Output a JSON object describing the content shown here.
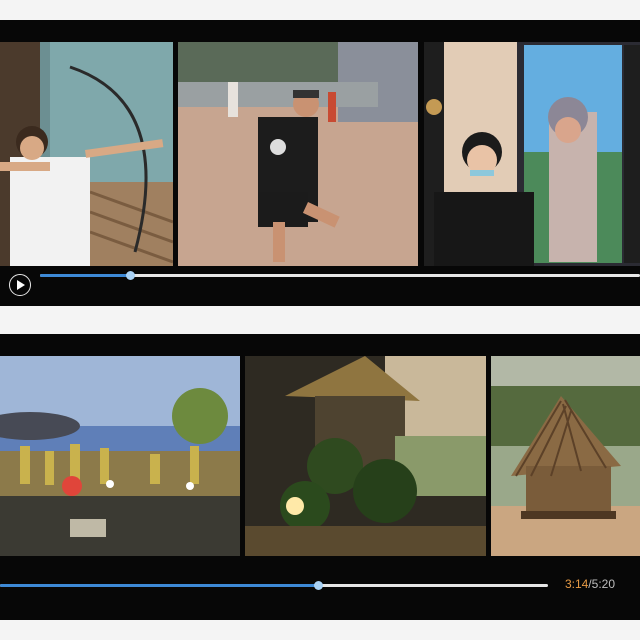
{
  "player1": {
    "progress": 0.15,
    "frames": [
      "archery-photo",
      "park-plaza-photo",
      "display-screen-photo"
    ]
  },
  "player2": {
    "progress": 0.58,
    "time_current": "3:14",
    "time_separator": "/",
    "time_total": "5:20",
    "frames": [
      "campfire-diorama-photo",
      "hut-lamp-diorama-photo",
      "thatched-hut-model-photo"
    ]
  },
  "colors": {
    "progress_fill": "#3d89d6",
    "time_current": "#e69a45"
  }
}
